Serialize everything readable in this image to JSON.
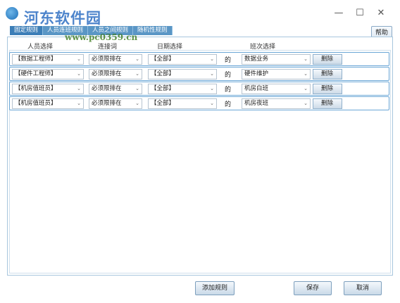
{
  "watermark": {
    "text": "河东软件园",
    "url": "www.pc0359.cn"
  },
  "window_controls": {
    "minimize": "—",
    "maximize": "☐",
    "close": "✕"
  },
  "tabs": [
    "固定规则",
    "人员连班规则",
    "人员之间规则",
    "随机性规则"
  ],
  "help_button": "帮助",
  "columns": {
    "person": "人员选择",
    "constraint": "连接词",
    "date": "日期选择",
    "shift": "班次选择"
  },
  "rules": [
    {
      "person": "【数据工程师】",
      "constraint": "必须限排在",
      "date": "【全部】",
      "connector": "的",
      "shift": "数据业务",
      "delete": "删除"
    },
    {
      "person": "【硬件工程师】",
      "constraint": "必须限排在",
      "date": "【全部】",
      "connector": "的",
      "shift": "硬件维护",
      "delete": "删除"
    },
    {
      "person": "【机房值班员】",
      "constraint": "必须限排在",
      "date": "【全部】",
      "connector": "的",
      "shift": "机房白班",
      "delete": "删除"
    },
    {
      "person": "【机房值班员】",
      "constraint": "必须限排在",
      "date": "【全部】",
      "connector": "的",
      "shift": "机房夜班",
      "delete": "删除"
    }
  ],
  "footer": {
    "add_rule": "添加规则",
    "save": "保存",
    "cancel": "取消"
  },
  "dropdown_arrow": "⌄"
}
